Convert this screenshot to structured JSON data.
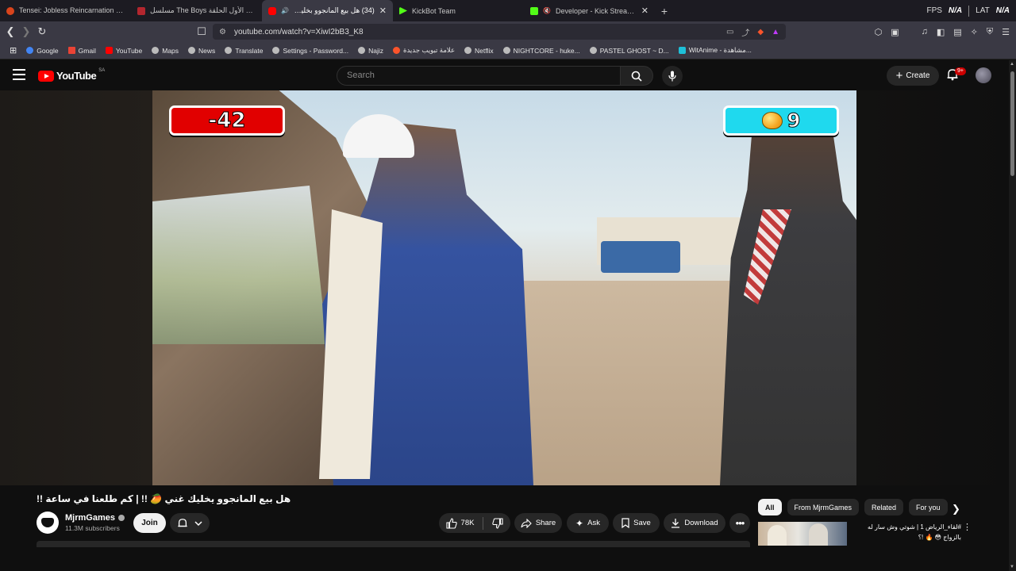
{
  "browser": {
    "tabs": [
      {
        "title": "Tensei: Jobless Reincarnation شاهد",
        "fav_color": "#d9441c",
        "active": false
      },
      {
        "title": "مسلسل The Boys الموسم الأول الحلقة",
        "fav_color": "#b3262e",
        "active": false
      },
      {
        "title": "(34) هل بيع المانجوو بخليك غني",
        "fav_color": "#ff0000",
        "active": true
      },
      {
        "title": "KickBot Team",
        "fav_color": "#53fc18",
        "active": false
      },
      {
        "title": "Developer - Kick Streaming",
        "fav_color": "#53fc18",
        "active": false
      }
    ],
    "new_tab_label": "+",
    "fps_label": "FPS",
    "fps_value": "N/A",
    "lat_label": "LAT",
    "lat_value": "N/A",
    "url": "youtube.com/watch?v=XiwI2bB3_K8",
    "bookmarks": [
      {
        "label": "Google",
        "color": "#4285f4"
      },
      {
        "label": "Gmail",
        "color": "#ea4335"
      },
      {
        "label": "YouTube",
        "color": "#ff0000"
      },
      {
        "label": "Maps",
        "color": "#bbbbbb"
      },
      {
        "label": "News",
        "color": "#bbbbbb"
      },
      {
        "label": "Translate",
        "color": "#bbbbbb"
      },
      {
        "label": "Settings - Password...",
        "color": "#bbbbbb"
      },
      {
        "label": "Najiz",
        "color": "#bbbbbb"
      },
      {
        "label": "علامة تبويب جديدة",
        "color": "#fb542b"
      },
      {
        "label": "Netflix",
        "color": "#bbbbbb"
      },
      {
        "label": "NIGHTCORE - huke...",
        "color": "#bbbbbb"
      },
      {
        "label": "PASTEL GHOST ~ D...",
        "color": "#bbbbbb"
      },
      {
        "label": "WitAnime - مشاهدة...",
        "color": "#1ec0d8"
      }
    ]
  },
  "youtube": {
    "logo_text": "YouTube",
    "region": "SA",
    "search_placeholder": "Search",
    "create_label": "Create",
    "notification_badge": "9+"
  },
  "video": {
    "score_left": "-42",
    "score_right": "9",
    "title": "هل بيع المانجوو يخليك غني 🥭 !! | كم طلعنا في ساعة !!"
  },
  "channel": {
    "name": "MjrmGames",
    "subscribers": "11.3M subscribers",
    "join_label": "Join"
  },
  "actions": {
    "likes": "78K",
    "share": "Share",
    "ask": "Ask",
    "save": "Save",
    "download": "Download"
  },
  "chips": [
    "All",
    "From MjrmGames",
    "Related",
    "For you"
  ],
  "recommendation": {
    "title": "#لقاء_الرياض 1 | شوتي وش سار له بالزواج 😳 🔥 !؟"
  }
}
